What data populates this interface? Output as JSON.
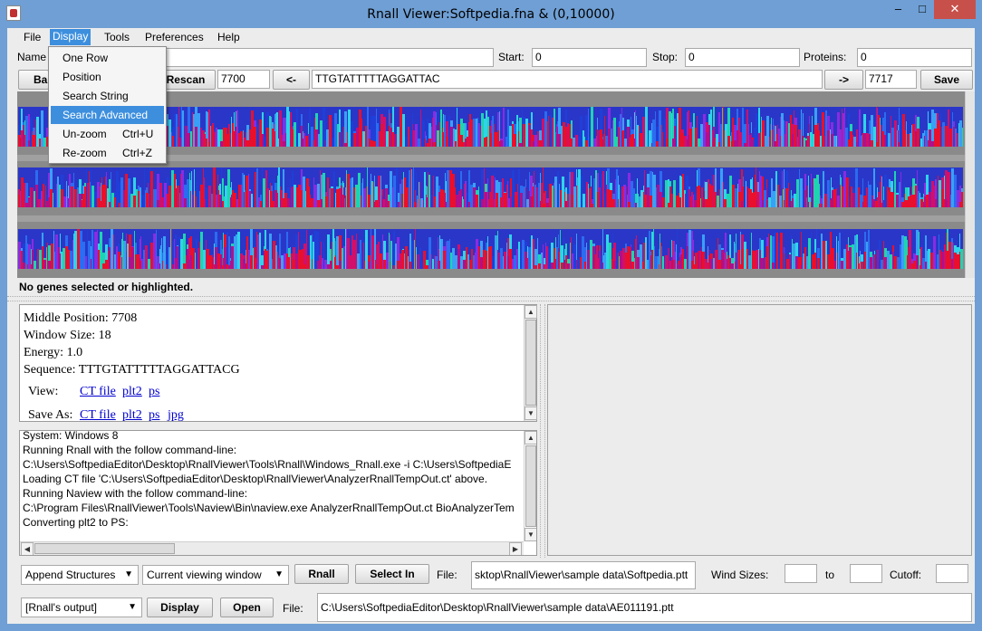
{
  "window": {
    "title": "Rnall Viewer:Softpedia.fna &  (0,10000)",
    "controls": {
      "minimize": "–",
      "maximize": "□",
      "close": "✕"
    }
  },
  "menubar": {
    "items": [
      "File",
      "Display",
      "Tools",
      "Preferences",
      "Help"
    ],
    "active": "Display"
  },
  "display_menu": {
    "items": [
      {
        "label": "One Row",
        "shortcut": ""
      },
      {
        "label": "Position",
        "shortcut": ""
      },
      {
        "label": "Search String",
        "shortcut": ""
      },
      {
        "label": "Search Advanced",
        "shortcut": ""
      },
      {
        "label": "Un-zoom",
        "shortcut": "Ctrl+U"
      },
      {
        "label": "Re-zoom",
        "shortcut": "Ctrl+Z"
      }
    ],
    "selected": "Search Advanced"
  },
  "toolbar1": {
    "name_label": "Name",
    "name_value": "",
    "start_label": "Start:",
    "start_value": "0",
    "stop_label": "Stop:",
    "stop_value": "0",
    "proteins_label": "Proteins:",
    "proteins_value": "0"
  },
  "toolbar2": {
    "back_label": "Ba",
    "rescan_label": "Rescan",
    "position_value": "7700",
    "prev_label": "<-",
    "sequence_value": "TTGTATTTTTAGGATTAC",
    "next_label": "->",
    "end_value": "7717",
    "save_label": "Save"
  },
  "colors": {
    "accent": "#3d8fde",
    "titlebar": "#6f9fd4",
    "close": "#c7504a",
    "link": "#0000d0"
  },
  "status": "No genes selected or highlighted.",
  "info": {
    "middle_position": "Middle Position: 7708",
    "window_size": "Window Size: 18",
    "energy": "Energy: 1.0",
    "sequence": "Sequence: TTTGTATTTTTAGGATTACG",
    "view_label": "View:",
    "view_links": [
      "CT file",
      "plt2",
      "ps"
    ],
    "save_label": "Save As:",
    "save_links": [
      "CT file",
      "plt2",
      "ps",
      "jpg"
    ]
  },
  "log": [
    "System: Windows 8",
    "Running Rnall with the follow command-line:",
    "C:\\Users\\SoftpediaEditor\\Desktop\\RnallViewer\\Tools\\Rnall\\Windows_Rnall.exe -i C:\\Users\\SoftpediaE",
    "Loading CT  file 'C:\\Users\\SoftpediaEditor\\Desktop\\RnallViewer\\AnalyzerRnallTempOut.ct' above.",
    "Running Naview with the follow command-line:",
    "C:\\Program Files\\RnallViewer\\Tools\\Naview\\Bin\\naview.exe AnalyzerRnallTempOut.ct BioAnalyzerTem",
    "Converting plt2 to PS:"
  ],
  "bottom1": {
    "mode_select": "Append Structures",
    "window_select": "Current viewing window",
    "rnall_label": "Rnall",
    "select_in_label": "Select In",
    "file_label": "File:",
    "file_value": "sktop\\RnallViewer\\sample data\\Softpedia.ptt",
    "wind_sizes_label": "Wind Sizes:",
    "wind_from": "",
    "to_label": "to",
    "wind_to": "",
    "cutoff_label": "Cutoff:",
    "cutoff_value": ""
  },
  "bottom2": {
    "output_select": "[Rnall's output]",
    "display_label": "Display",
    "open_label": "Open",
    "file_label": "File:",
    "file_value": "C:\\Users\\SoftpediaEditor\\Desktop\\RnallViewer\\sample data\\AE011191.ptt"
  }
}
